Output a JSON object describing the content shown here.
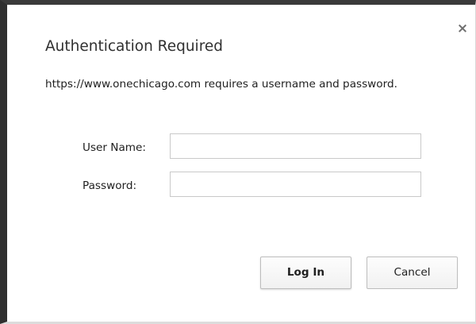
{
  "dialog": {
    "title": "Authentication Required",
    "close_icon": "×",
    "message": "https://www.onechicago.com requires a username and password."
  },
  "form": {
    "username_label": "User Name:",
    "username_value": "",
    "password_label": "Password:",
    "password_value": ""
  },
  "buttons": {
    "login_label": "Log In",
    "cancel_label": "Cancel"
  },
  "icons": {
    "close": "close-icon"
  }
}
